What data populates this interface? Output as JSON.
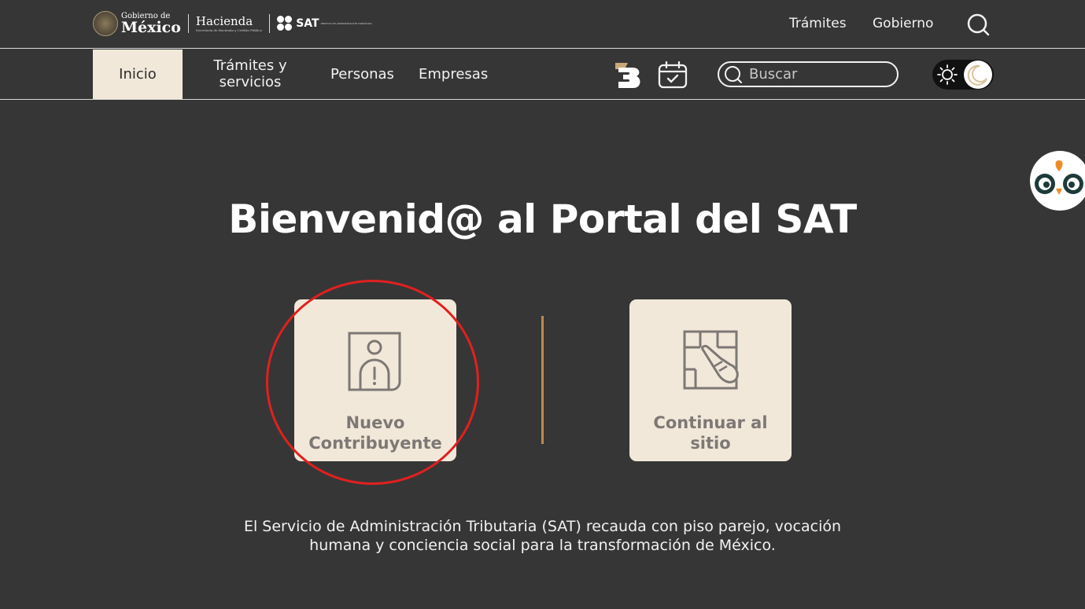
{
  "header": {
    "logo_gobierno_small": "Gobierno de",
    "logo_gobierno_big": "México",
    "logo_hacienda": "Hacienda",
    "logo_hacienda_sub": "Secretaría de Hacienda y Crédito Público",
    "logo_sat": "SAT",
    "logo_sat_sub": "SERVICIO DE ADMINISTRACIÓN TRIBUTARIA",
    "links": [
      "Trámites",
      "Gobierno"
    ],
    "search_icon": "search-icon"
  },
  "nav": {
    "items": [
      "Inicio",
      "Trámites y",
      "servicios",
      "Personas",
      "Empresas"
    ],
    "search_placeholder": "Buscar",
    "active_item": "Inicio",
    "theme": "dark"
  },
  "main": {
    "title": "Bienvenid@ al Portal del SAT",
    "cards": [
      {
        "line1": "Nuevo",
        "line2": "Contribuyente",
        "icon": "person-alert-icon"
      },
      {
        "line1": "Continuar al",
        "line2": "sitio",
        "icon": "hand-click-icon"
      }
    ],
    "description_line1": "El Servicio de Administración Tributaria (SAT) recauda con piso parejo, vocación",
    "description_line2": "humana y conciencia social para la transformación de México."
  },
  "colors": {
    "background": "#363636",
    "card": "#f1e8d9",
    "accent_gold": "#b88d4f",
    "highlight_red": "#e02020"
  }
}
